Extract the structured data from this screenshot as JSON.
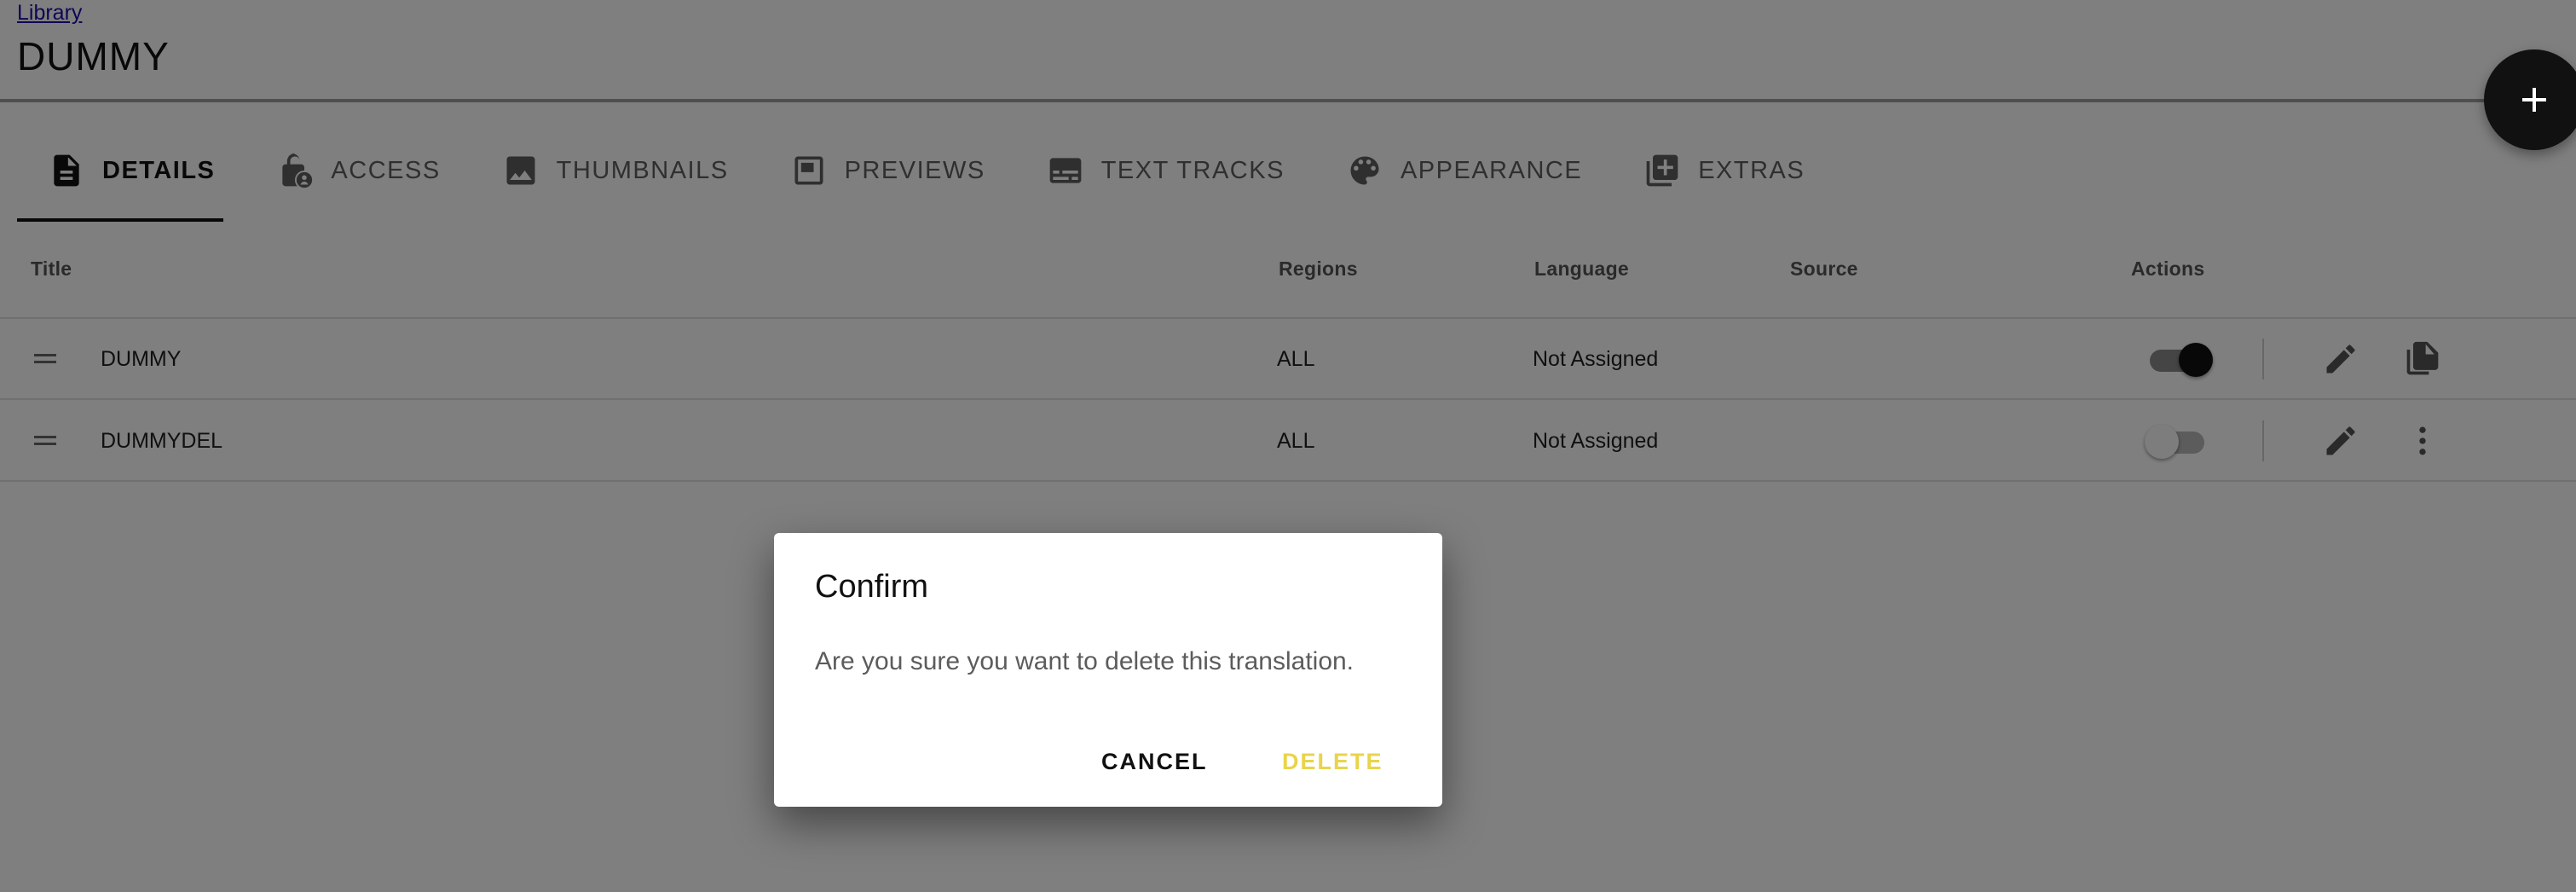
{
  "header": {
    "breadcrumb": "Library",
    "title": "DUMMY"
  },
  "fab": {
    "icon": "plus-icon"
  },
  "tabs": [
    {
      "label": "DETAILS",
      "icon": "document-icon",
      "active": true
    },
    {
      "label": "ACCESS",
      "icon": "lock-user-icon",
      "active": false
    },
    {
      "label": "THUMBNAILS",
      "icon": "image-icon",
      "active": false
    },
    {
      "label": "PREVIEWS",
      "icon": "preview-icon",
      "active": false
    },
    {
      "label": "TEXT TRACKS",
      "icon": "subtitles-icon",
      "active": false
    },
    {
      "label": "APPEARANCE",
      "icon": "palette-icon",
      "active": false
    },
    {
      "label": "EXTRAS",
      "icon": "library-add-icon",
      "active": false
    }
  ],
  "table": {
    "columns": [
      "Title",
      "Regions",
      "Language",
      "Source",
      "Actions"
    ],
    "rows": [
      {
        "title": "DUMMY",
        "regions": "ALL",
        "language": "Not Assigned",
        "source": "",
        "enabled": true,
        "secondary_action": "copy-icon"
      },
      {
        "title": "DUMMYDEL",
        "regions": "ALL",
        "language": "Not Assigned",
        "source": "",
        "enabled": false,
        "secondary_action": "more-vert-icon"
      }
    ]
  },
  "dialog": {
    "title": "Confirm",
    "message": "Are you sure you want to delete this translation.",
    "cancel_label": "CANCEL",
    "delete_label": "DELETE"
  },
  "colors": {
    "accent": "#111111",
    "delete_button": "#e9d44a",
    "scrim": "rgba(0,0,0,0.5)"
  }
}
